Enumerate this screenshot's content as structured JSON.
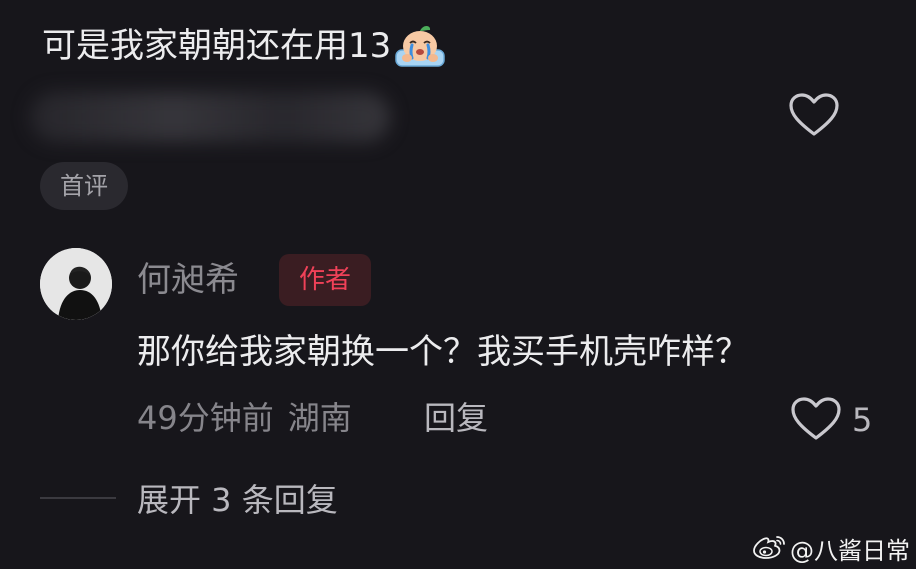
{
  "comment": {
    "text": "可是我家朝朝还在用13",
    "emoji": "crying-emoji",
    "first_badge": "首评"
  },
  "reply": {
    "author_name": "何昶希",
    "author_tag": "作者",
    "text": "那你给我家朝换一个？我买手机壳咋样？",
    "time": "49分钟前",
    "location": "湖南",
    "reply_action": "回复",
    "like_count": "5"
  },
  "expand_replies": "展开 3 条回复",
  "watermark": {
    "text": "@八酱日常",
    "icon": "weibo-icon"
  },
  "colors": {
    "background": "#17161b",
    "author_tag": "#f04158"
  }
}
